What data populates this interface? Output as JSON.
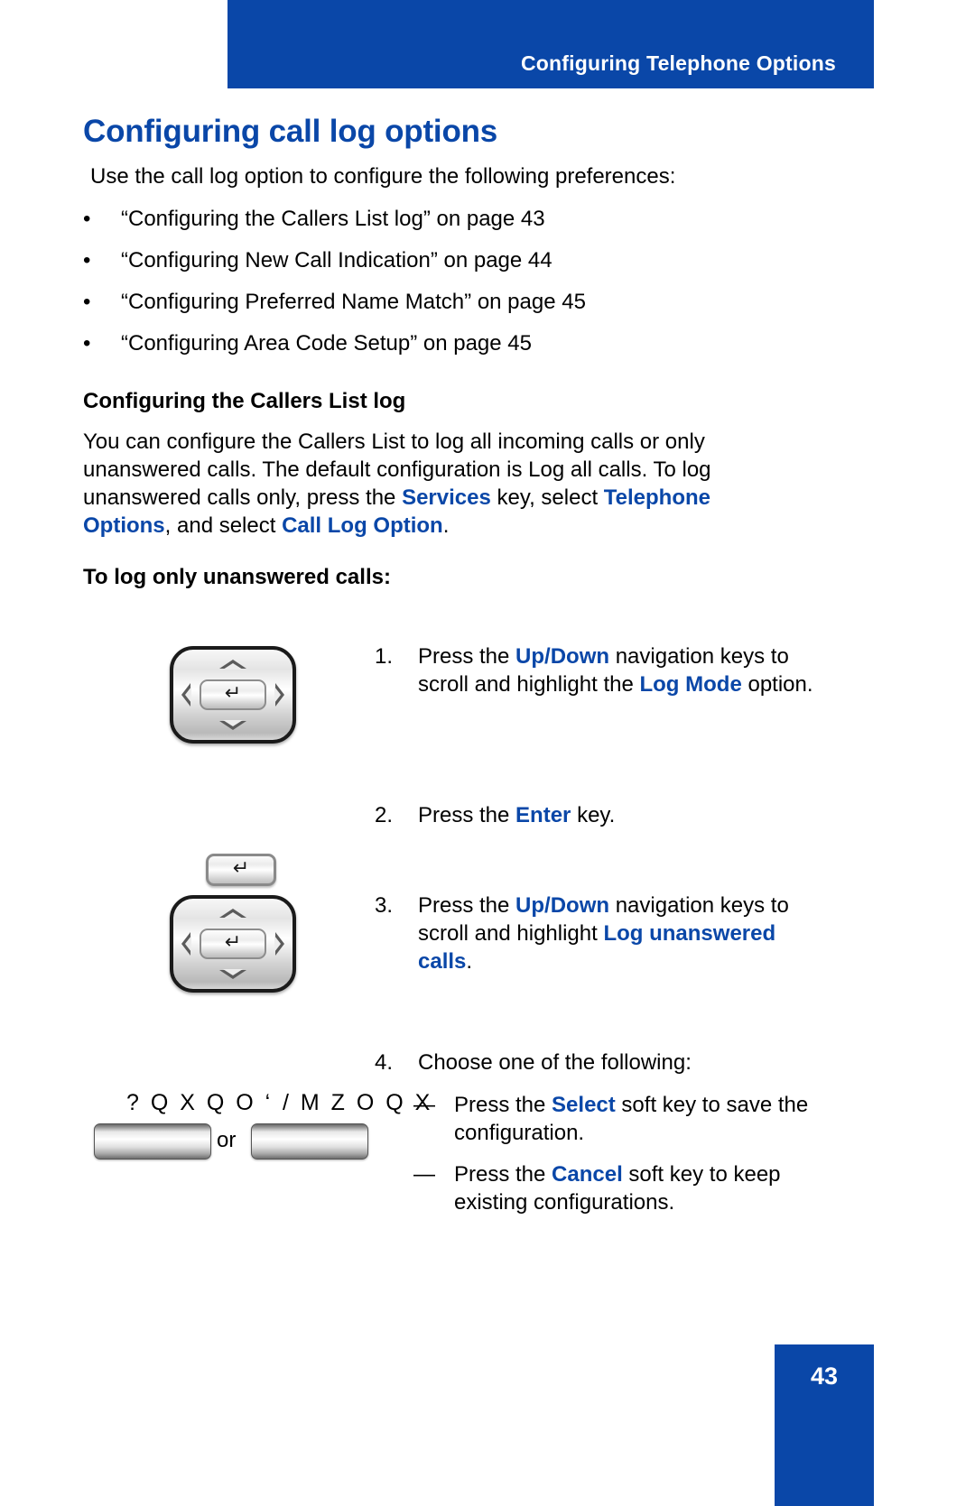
{
  "header": {
    "title": "Configuring Telephone Options",
    "bar_color": "#0A47A8"
  },
  "chapter": {
    "title": "Configuring call log options"
  },
  "intro": {
    "text": "Use the call log option to configure the following preferences:"
  },
  "bullets": [
    {
      "marker": "•",
      "text": "“Configuring the Callers List log” on page 43"
    },
    {
      "marker": "•",
      "text": "“Configuring New Call Indication” on page 44"
    },
    {
      "marker": "•",
      "text": "“Configuring Preferred Name Match” on page 45"
    },
    {
      "marker": "•",
      "text": "“Configuring Area Code Setup” on page 45"
    }
  ],
  "section": {
    "heading": "Configuring the Callers List log",
    "paragraph": {
      "part1": "You can configure the Callers List to log all incoming calls or only unanswered calls. The default configuration is Log all calls. To log unanswered calls only, press the ",
      "bold1": "Services",
      "part2": " key, select ",
      "bold2": "Telephone Options",
      "part3": ", and select ",
      "bold3": "Call Log Option",
      "part4": "."
    },
    "procedure_heading": "To log only unanswered calls:"
  },
  "steps": [
    {
      "number": "1.",
      "part1": "Press the ",
      "bold1": "Up/Down",
      "part2": " navigation keys to scroll and highlight the ",
      "bold2": "Log Mode",
      "part3": " option."
    },
    {
      "number": "2.",
      "part1": "Press the ",
      "bold1": "Enter",
      "part2": " key.",
      "bold2": "",
      "part3": ""
    },
    {
      "number": "3.",
      "part1": "Press the ",
      "bold1": "Up/Down",
      "part2": " navigation keys to scroll and highlight ",
      "bold2": "Log unanswered calls",
      "part3": "."
    },
    {
      "number": "4.",
      "part1": "Choose one of the following:",
      "bold1": "",
      "part2": "",
      "bold2": "",
      "part3": ""
    }
  ],
  "substeps": [
    {
      "dash": "—",
      "part1": "Press the ",
      "bold1": "Select",
      "part2": " soft key to save the configuration."
    },
    {
      "dash": "—",
      "part1": "Press the ",
      "bold1": "Cancel",
      "part2": " soft key to keep existing configurations."
    }
  ],
  "softkeys": {
    "label_select": "? Q X Q O ‘",
    "label_cancel": "/ M Z O Q X",
    "or": "or"
  },
  "keys": {
    "enter_glyph": "↵"
  },
  "footer": {
    "page_number": "43",
    "block_color": "#0A47A8"
  }
}
